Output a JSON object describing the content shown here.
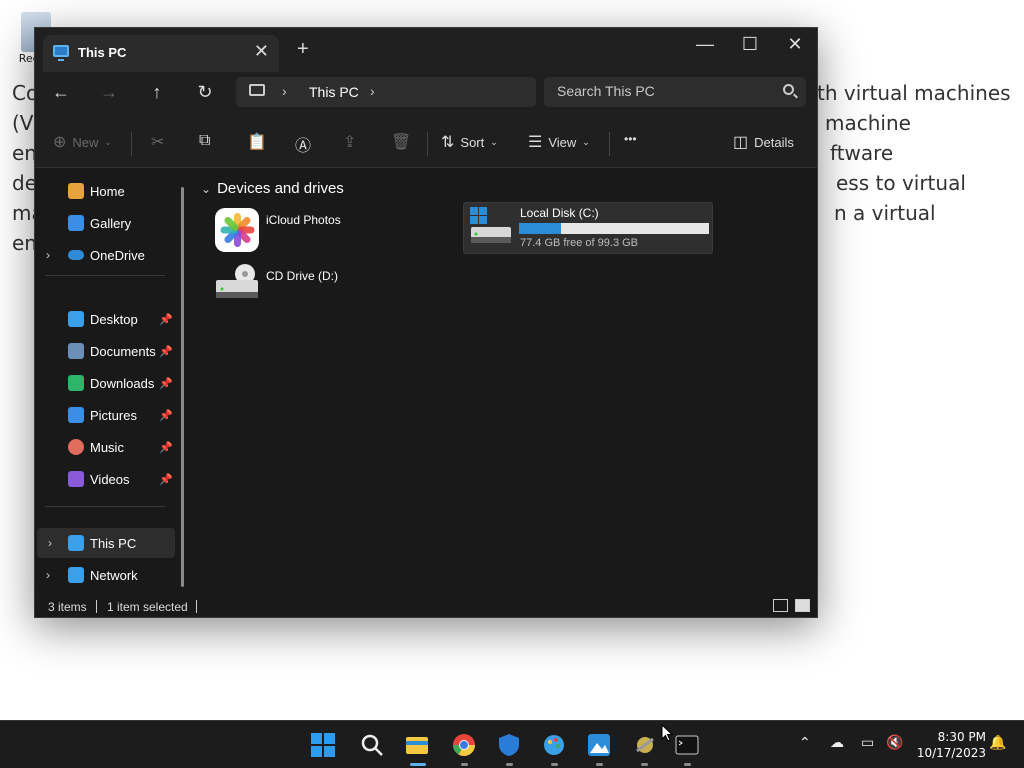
{
  "desktop": {
    "recycle_bin_label": "Recy",
    "background_lines": [
      {
        "left": "Co",
        "right": "th virtual machines"
      },
      {
        "left": "(V",
        "right": "machine"
      },
      {
        "left": "en",
        "right": "ftware"
      },
      {
        "left": "de",
        "right": "ess to virtual"
      },
      {
        "left": "ma",
        "right": "n a virtual"
      },
      {
        "left": "en",
        "right": ""
      }
    ]
  },
  "window": {
    "tab_title": "This PC",
    "tab_close": "✕",
    "new_tab": "+",
    "minimize": "—",
    "maximize": "☐",
    "close": "✕"
  },
  "address": {
    "back": "←",
    "forward": "→",
    "up": "↑",
    "refresh": "↻",
    "breadcrumb": "This PC",
    "sep": "›",
    "search_placeholder": "Search This PC"
  },
  "toolbar": {
    "new_label": "New",
    "sort_label": "Sort",
    "view_label": "View",
    "more_label": "•••",
    "details_label": "Details",
    "cut_glyph": "✂",
    "copy_glyph": "⧉",
    "paste_glyph": "📋",
    "rename_glyph": "Ⓐ",
    "share_glyph": "⇪",
    "delete_glyph": "🗑"
  },
  "sidebar": {
    "items": [
      {
        "label": "Home",
        "icon": "home-icon",
        "color": "#e8a33d"
      },
      {
        "label": "Gallery",
        "icon": "gallery-icon",
        "color": "#3a8ee6"
      },
      {
        "label": "OneDrive",
        "icon": "onedrive-icon",
        "color": "#2f8bd8"
      },
      {
        "label": "Desktop",
        "icon": "desktop-icon",
        "color": "#3aa0e8"
      },
      {
        "label": "Documents",
        "icon": "documents-icon",
        "color": "#6c8fb8"
      },
      {
        "label": "Downloads",
        "icon": "downloads-icon",
        "color": "#2fb56a"
      },
      {
        "label": "Pictures",
        "icon": "pictures-icon",
        "color": "#3a8ee6"
      },
      {
        "label": "Music",
        "icon": "music-icon",
        "color": "#e06c5c"
      },
      {
        "label": "Videos",
        "icon": "videos-icon",
        "color": "#8a5ad8"
      },
      {
        "label": "This PC",
        "icon": "this-pc-icon",
        "color": "#3aa0e8"
      },
      {
        "label": "Network",
        "icon": "network-icon",
        "color": "#3aa0e8"
      }
    ]
  },
  "content": {
    "group_header": "Devices and drives",
    "icloud_label": "iCloud Photos",
    "cd_label": "CD Drive (D:)",
    "disk_label": "Local Disk (C:)",
    "disk_free": "77.4 GB free of 99.3 GB",
    "disk_used_fraction": 0.22
  },
  "status": {
    "items_count": "3 items",
    "selected": "1 item selected"
  },
  "taskbar": {
    "apps": [
      "start-icon",
      "search-icon",
      "file-explorer-icon",
      "chrome-icon",
      "defender-icon",
      "paint-icon",
      "photos-icon",
      "app-icon",
      "terminal-icon"
    ],
    "time": "8:30 PM",
    "date": "10/17/2023"
  }
}
